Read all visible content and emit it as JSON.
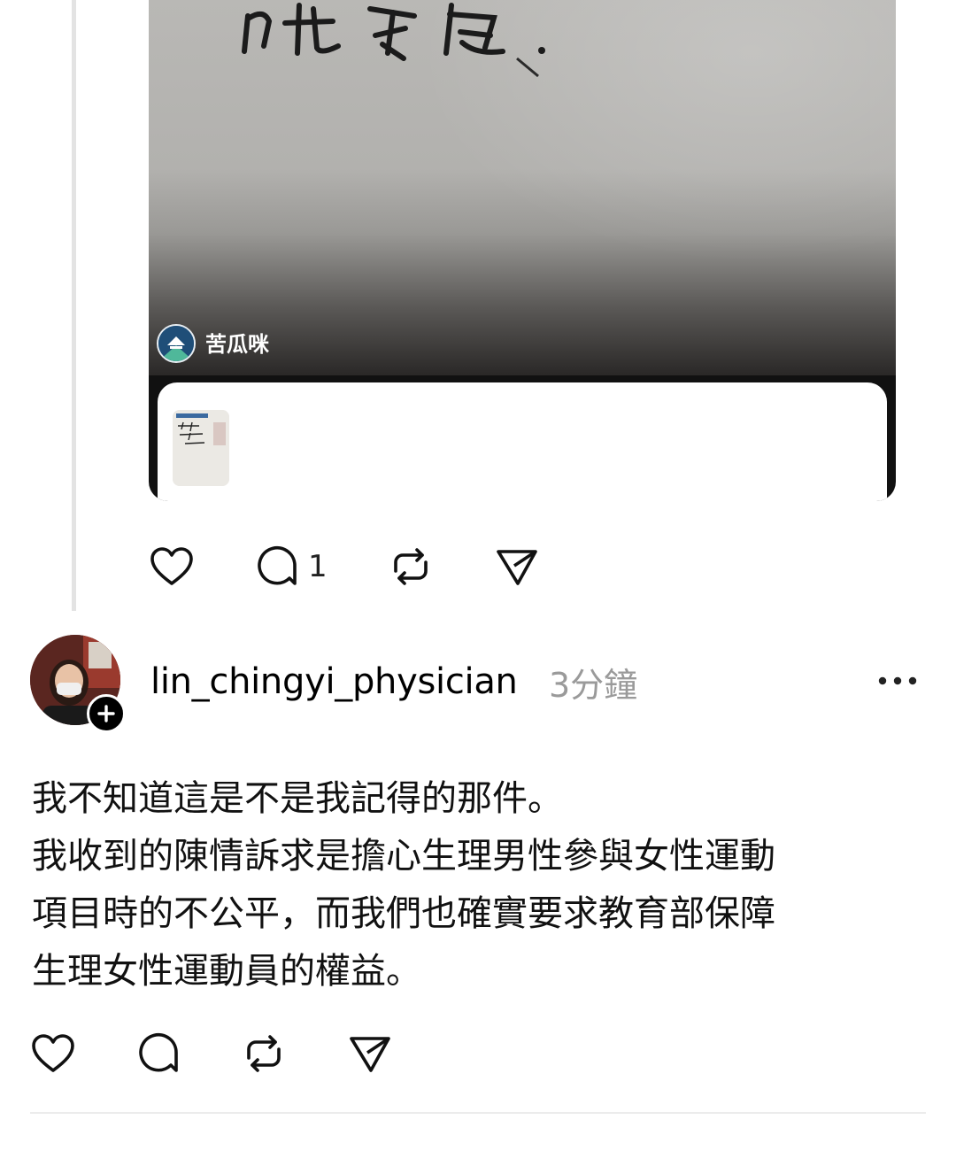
{
  "thread_post": {
    "media_source_name": "苦瓜咪",
    "actions": {
      "like_icon": "heart-icon",
      "reply_icon": "comment-icon",
      "reply_count": "1",
      "repost_icon": "repost-icon",
      "share_icon": "send-icon"
    }
  },
  "post": {
    "username": "lin_chingyi_physician",
    "timestamp": "3分鐘",
    "more_icon": "more-horizontal-icon",
    "body_lines": [
      "我不知道這是不是我記得的那件。",
      "我收到的陳情訴求是擔心生理男性參與女性運動",
      "項目時的不公平，而我們也確實要求教育部保障",
      "生理女性運動員的權益。"
    ],
    "actions": {
      "like_icon": "heart-icon",
      "reply_icon": "comment-icon",
      "repost_icon": "repost-icon",
      "share_icon": "send-icon"
    }
  },
  "colors": {
    "text": "#000000",
    "muted": "#9a9a9a",
    "thread_line": "#e3e3e3",
    "divider": "#ececec"
  }
}
